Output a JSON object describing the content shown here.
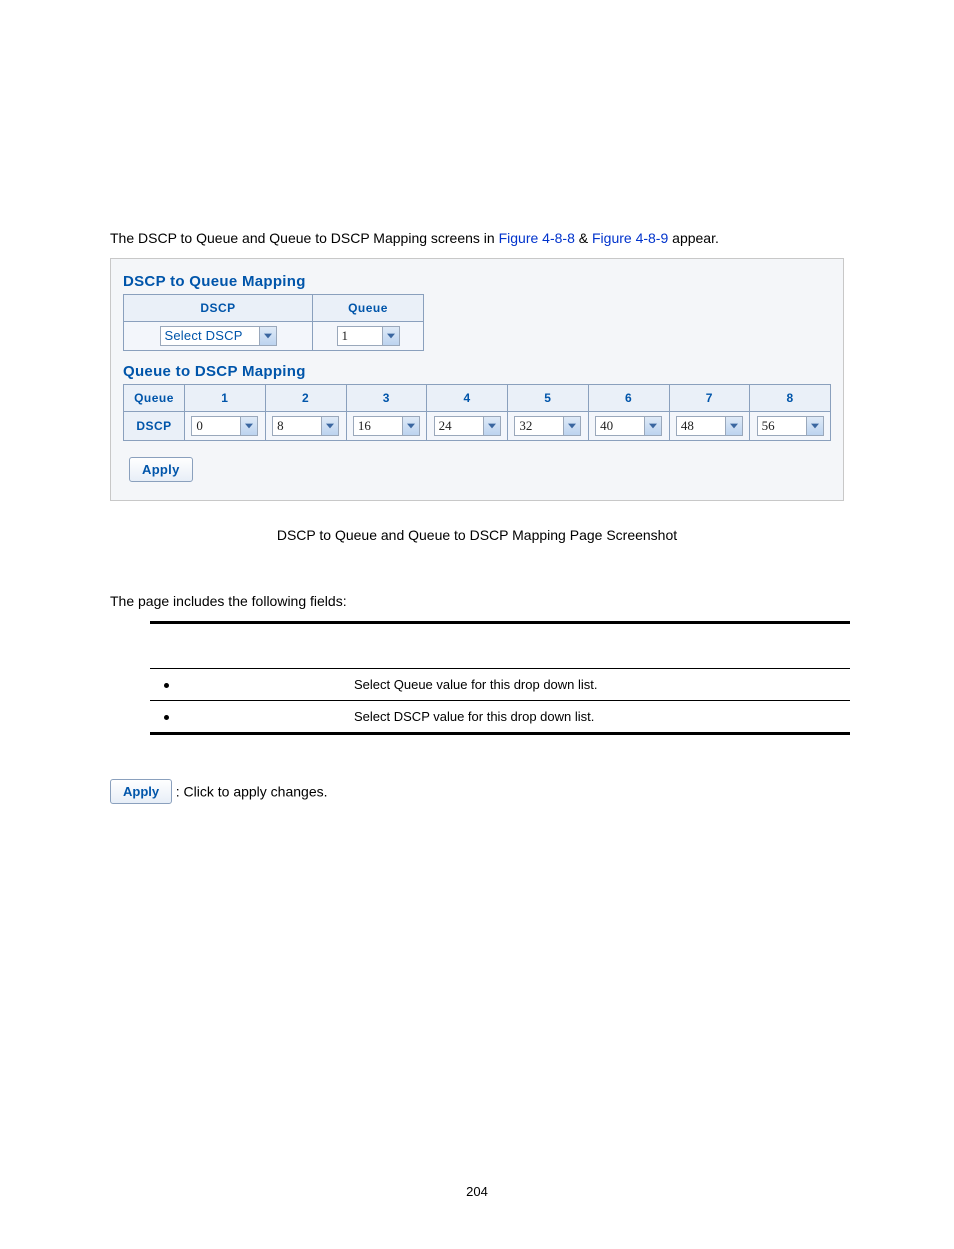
{
  "intro": {
    "pre": "The DSCP to Queue and Queue to DSCP Mapping screens in ",
    "link1": "Figure 4-8-8",
    "amp": " & ",
    "link2": "Figure 4-8-9",
    "post": " appear."
  },
  "d2q": {
    "title": "DSCP to Queue Mapping",
    "col1": "DSCP",
    "col2": "Queue",
    "dscp_select": "Select DSCP",
    "queue_select": "1"
  },
  "q2d": {
    "title": "Queue to DSCP Mapping",
    "row_label": "Queue",
    "dscp_label": "DSCP",
    "cols": [
      "1",
      "2",
      "3",
      "4",
      "5",
      "6",
      "7",
      "8"
    ],
    "values": [
      "0",
      "8",
      "16",
      "24",
      "32",
      "40",
      "48",
      "56"
    ]
  },
  "apply_label": "Apply",
  "caption": "DSCP to Queue and Queue to DSCP Mapping Page Screenshot",
  "fields_intro": "The page includes the following fields:",
  "fields": [
    {
      "obj": "",
      "desc": "Select Queue value for this drop down list."
    },
    {
      "obj": "",
      "desc": "Select DSCP value for this drop down list."
    }
  ],
  "buttons_note": ": Click to apply changes.",
  "page_number": "204"
}
